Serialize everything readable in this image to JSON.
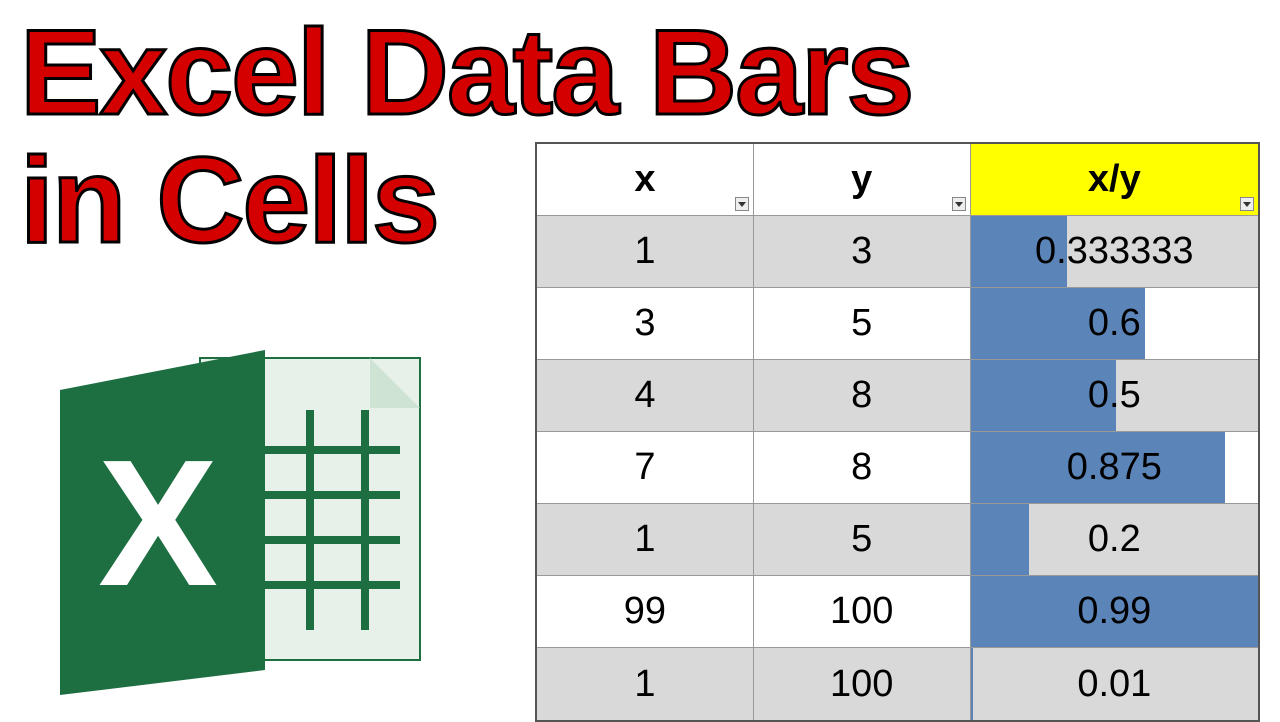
{
  "title_line1": "Excel Data Bars",
  "title_line2": "in Cells",
  "table": {
    "headers": {
      "x": "x",
      "y": "y",
      "xy": "x/y"
    },
    "rows": [
      {
        "x": "1",
        "y": "3",
        "xy": "0.333333",
        "bar": 33.7
      },
      {
        "x": "3",
        "y": "5",
        "xy": "0.6",
        "bar": 60.6
      },
      {
        "x": "4",
        "y": "8",
        "xy": "0.5",
        "bar": 50.5
      },
      {
        "x": "7",
        "y": "8",
        "xy": "0.875",
        "bar": 88.4
      },
      {
        "x": "1",
        "y": "5",
        "xy": "0.2",
        "bar": 20.2
      },
      {
        "x": "99",
        "y": "100",
        "xy": "0.99",
        "bar": 100
      },
      {
        "x": "1",
        "y": "100",
        "xy": "0.01",
        "bar": 1.0
      }
    ]
  }
}
